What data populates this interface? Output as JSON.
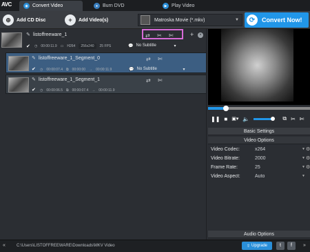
{
  "app": {
    "logo": "AVC"
  },
  "tabs": [
    {
      "label": "Convert Video"
    },
    {
      "label": "Burn DVD"
    },
    {
      "label": "Play Video"
    }
  ],
  "toolbar": {
    "add_cd_label": "Add CD Disc",
    "add_video_label": "Add Video(s)",
    "format_value": "Matroska Movie (*.mkv)",
    "convert_label": "Convert Now!"
  },
  "files": [
    {
      "name": "listoffreeware_1",
      "duration": "00:00:11.9",
      "codec": "H264",
      "resolution": "256x240",
      "fps": "25 FPS",
      "subtitle": "No Subtitle"
    },
    {
      "name": "listoffreeware_1_Segment_0",
      "duration": "00:00:07.4",
      "start": "00:00:00",
      "end": "00:00:11.9",
      "subtitle": "No Subtitle"
    },
    {
      "name": "listoffreeware_1_Segment_1",
      "duration": "00:00:06.5",
      "start": "00:00:07.4",
      "end": "00:00:11.9"
    }
  ],
  "settings": {
    "basic_label": "Basic Settings",
    "video_options_label": "Video Options",
    "audio_options_label": "Audio Options",
    "rows": [
      {
        "label": "Video Codec:",
        "value": "x264"
      },
      {
        "label": "Video Bitrate:",
        "value": "2000"
      },
      {
        "label": "Frame Rate:",
        "value": "25"
      },
      {
        "label": "Video Aspect:",
        "value": "Auto"
      }
    ]
  },
  "status": {
    "path": "C:\\Users\\LISTOFFREEWARE\\Downloads\\MKV Video",
    "upgrade_label": "Upgrade"
  }
}
